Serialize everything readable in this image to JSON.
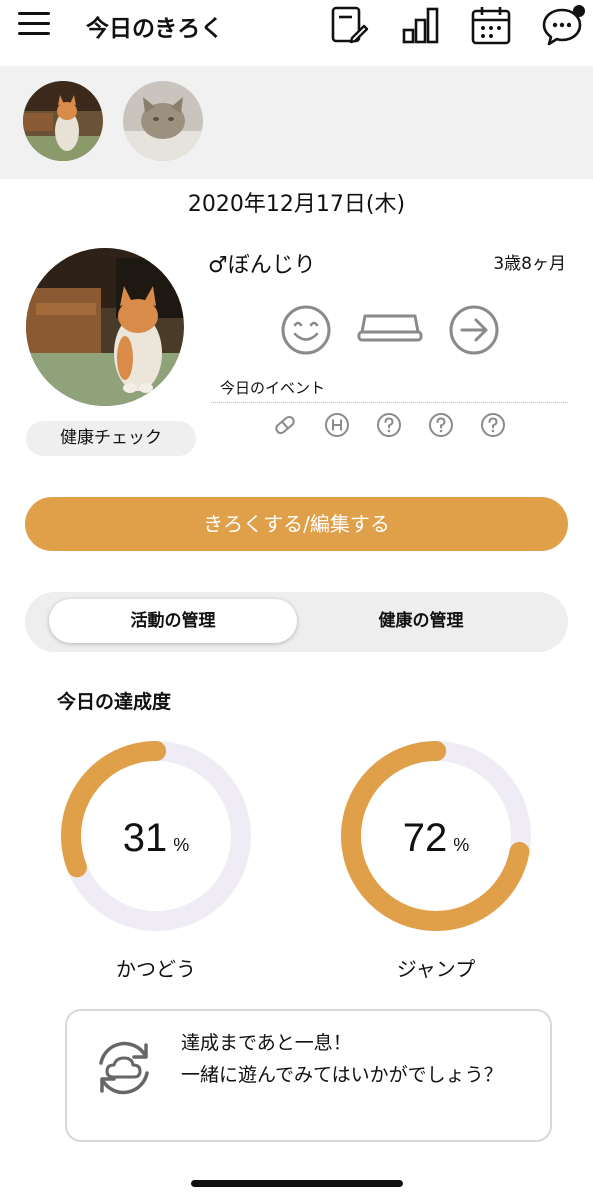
{
  "header": {
    "title": "今日のきろく",
    "icons": [
      "menu-icon",
      "edit-note-icon",
      "bar-chart-icon",
      "calendar-icon",
      "chat-icon"
    ],
    "notification_dot": true
  },
  "pets": [
    {
      "name": "ぼんじり",
      "selected": true
    },
    {
      "name": "",
      "selected": false
    }
  ],
  "date": "2020年12月17日(木)",
  "profile": {
    "gender_symbol": "♂",
    "name": "ぼんじり",
    "age": "3歳8ヶ月",
    "health_check_label": "健康チェック",
    "status_icons": [
      "smile-face-icon",
      "food-bowl-icon",
      "arrow-right-circle-icon"
    ],
    "event_label": "今日のイベント",
    "event_icons": [
      "pill-icon",
      "hospital-h-icon",
      "question-icon",
      "question-icon",
      "question-icon"
    ]
  },
  "record_button": "きろくする/編集する",
  "tabs": [
    {
      "label": "活動の管理",
      "active": true
    },
    {
      "label": "健康の管理",
      "active": false
    }
  ],
  "achievement": {
    "title": "今日の達成度",
    "items": [
      {
        "label": "かつどう",
        "value": "31",
        "unit": "%",
        "fraction": 0.31
      },
      {
        "label": "ジャンプ",
        "value": "72",
        "unit": "%",
        "fraction": 0.72
      }
    ]
  },
  "message": {
    "line1": "達成まであと一息！",
    "line2": "一緒に遊んでみてはいかがでしょう？"
  },
  "colors": {
    "accent": "#e0a04a",
    "ring_track": "#efecf6",
    "strip_bg": "#f1f1f1"
  }
}
